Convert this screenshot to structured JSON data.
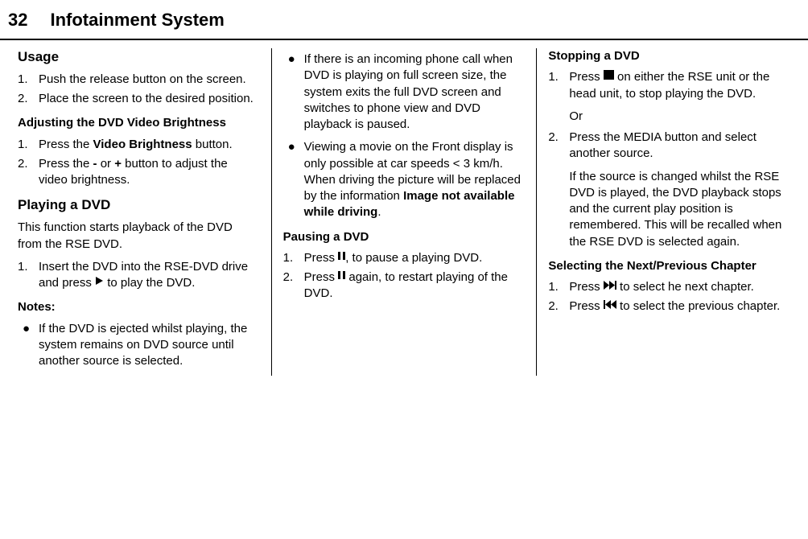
{
  "header": {
    "page_num": "32",
    "title": "Infotainment System"
  },
  "col1": {
    "usage_heading": "Usage",
    "usage_items": [
      "Push the release button on the screen.",
      "Place the screen to the desired position."
    ],
    "brightness_heading": "Adjusting the DVD Video Brightness",
    "brightness_1_pre": "Press the ",
    "brightness_1_bold": "Video Brightness",
    "brightness_1_post": " button.",
    "brightness_2_pre": "Press the ",
    "brightness_2_b1": "-",
    "brightness_2_mid": " or ",
    "brightness_2_b2": "+",
    "brightness_2_post": " button to adjust the video brightness.",
    "playing_heading": "Playing a DVD",
    "playing_intro": "This function starts playback of the DVD from the RSE DVD.",
    "playing_1_pre": "Insert the DVD into the RSE-DVD drive and press ",
    "playing_1_post": " to play the DVD.",
    "notes_heading": "Notes:",
    "note1": "If the DVD is ejected whilst playing, the system remains on DVD source until another source is selected."
  },
  "col2": {
    "note2": "If there is an incoming phone call when DVD is playing on full screen size, the system exits the full DVD screen and switches to phone view and DVD playback is paused.",
    "note3_pre": "Viewing a movie on the Front display is only possible at car speeds < 3 km/h. When driving the picture will be replaced by the information ",
    "note3_bold": "Image not available while driving",
    "note3_post": ".",
    "pausing_heading": "Pausing a DVD",
    "pausing_1_pre": "Press ",
    "pausing_1_post": ", to pause a playing DVD.",
    "pausing_2_pre": "Press ",
    "pausing_2_post": " again, to restart playing of the DVD."
  },
  "col3": {
    "stopping_heading": "Stopping a DVD",
    "stopping_1_pre": "Press ",
    "stopping_1_post": " on either the RSE unit or the head unit, to stop playing the DVD.",
    "stopping_or": "Or",
    "stopping_2": "Press the MEDIA button and select another source.",
    "stopping_para": "If the source is changed whilst the RSE DVD is played, the DVD playback stops and the current play position is remembered. This will be recalled when the RSE DVD is selected again.",
    "chapter_heading": "Selecting the Next/Previous Chapter",
    "chapter_1_pre": "Press ",
    "chapter_1_post": " to select he next chapter.",
    "chapter_2_pre": "Press ",
    "chapter_2_post": " to select the previous chapter."
  },
  "labels": {
    "n1": "1.",
    "n2": "2.",
    "bullet": "●"
  }
}
